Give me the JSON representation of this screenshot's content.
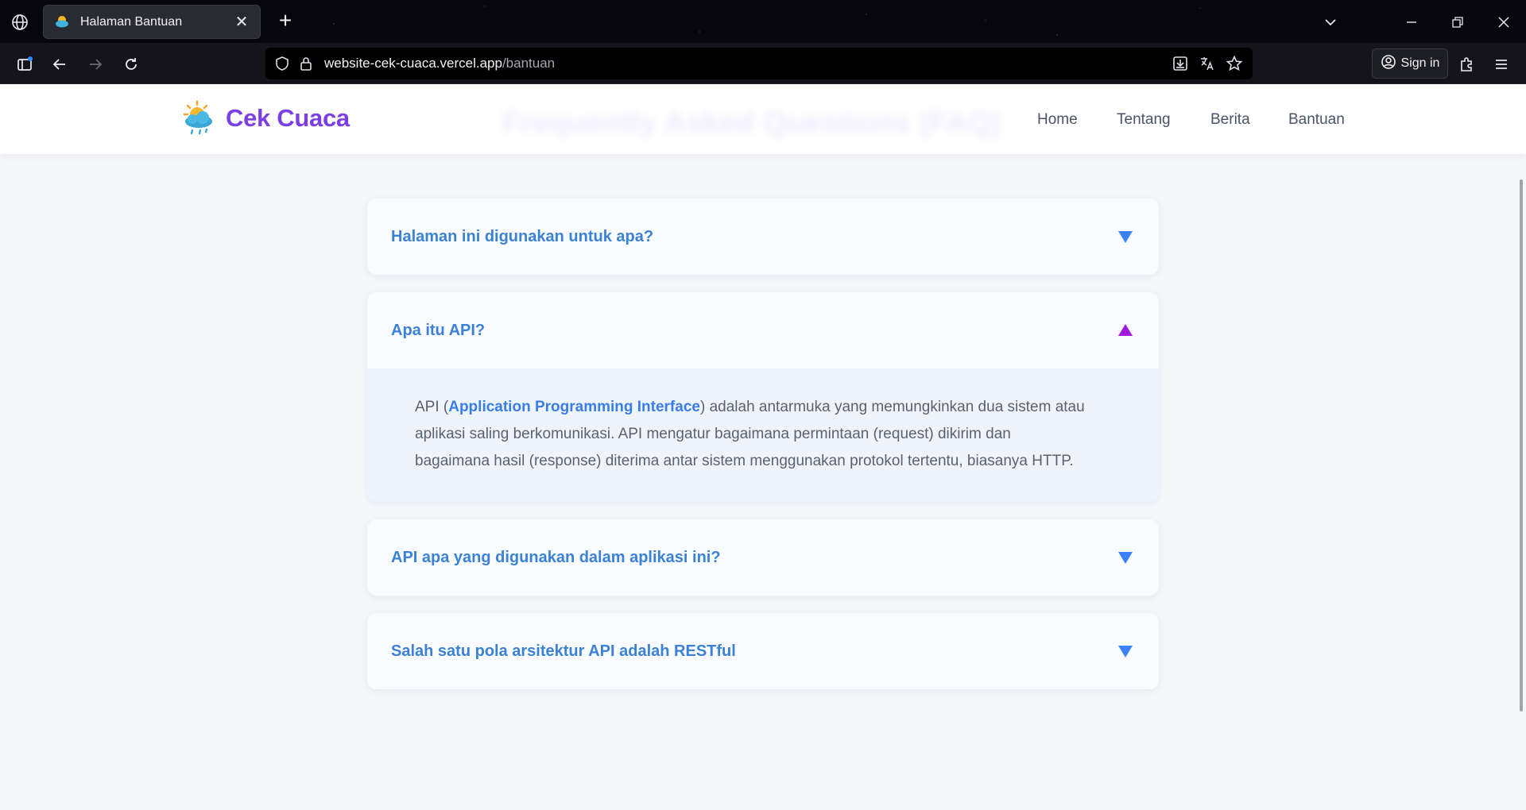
{
  "browser": {
    "tab_title": "Halaman Bantuan",
    "url_domain": "website-cek-cuaca.vercel.app",
    "url_path": "/bantuan",
    "signin_label": "Sign in"
  },
  "site": {
    "brand": "Cek Cuaca",
    "ghost_title": "Frequently Asked Questions (FAQ)",
    "nav": [
      "Home",
      "Tentang",
      "Berita",
      "Bantuan"
    ]
  },
  "faq": [
    {
      "question": "Halaman ini digunakan untuk apa?",
      "expanded": false
    },
    {
      "question": "Apa itu API?",
      "expanded": true,
      "answer_prefix": "API (",
      "answer_bold": "Application Programming Interface",
      "answer_rest": ") adalah antarmuka yang memungkinkan dua sistem atau aplikasi saling berkomunikasi. API mengatur bagaimana permintaan (request) dikirim dan bagaimana hasil (response) diterima antar sistem menggunakan protokol tertentu, biasanya HTTP."
    },
    {
      "question": "API apa yang digunakan dalam aplikasi ini?",
      "expanded": false
    },
    {
      "question": "Salah satu pola arsitektur API adalah RESTful",
      "expanded": false
    }
  ],
  "colors": {
    "brand": "#7b3fe4",
    "question": "#3b82d6",
    "arrow_collapsed": "#3b82f6",
    "arrow_expanded": "#a21cdb"
  },
  "icons": {
    "collapsed": "triangle-down-icon",
    "expanded": "triangle-up-icon"
  }
}
